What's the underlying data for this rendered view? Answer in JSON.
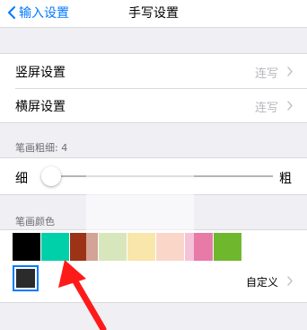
{
  "nav": {
    "back_label": "输入设置",
    "title": "手写设置"
  },
  "rows": {
    "portrait": {
      "title": "竖屏设置",
      "value": "连写"
    },
    "landscape": {
      "title": "横屏设置",
      "value": "连写"
    }
  },
  "stroke": {
    "label": "笔画粗细: 4",
    "thin_label": "细",
    "thick_label": "粗",
    "level_fraction": 0.02
  },
  "color_section": {
    "label": "笔画颜色",
    "swatches": [
      "#000000",
      "#00d0a9",
      "#9c3317",
      "#a8c86a",
      "#f0c846",
      "#f4a488",
      "#e87aa8",
      "#6fb82d"
    ],
    "current_color": "#2b2b2b",
    "custom_label": "自定义"
  },
  "colors": {
    "accent": "#007aff",
    "arrow": "#ff1a1a"
  },
  "icons": {
    "back": "chevron-left-icon",
    "disclosure": "chevron-right-icon"
  }
}
